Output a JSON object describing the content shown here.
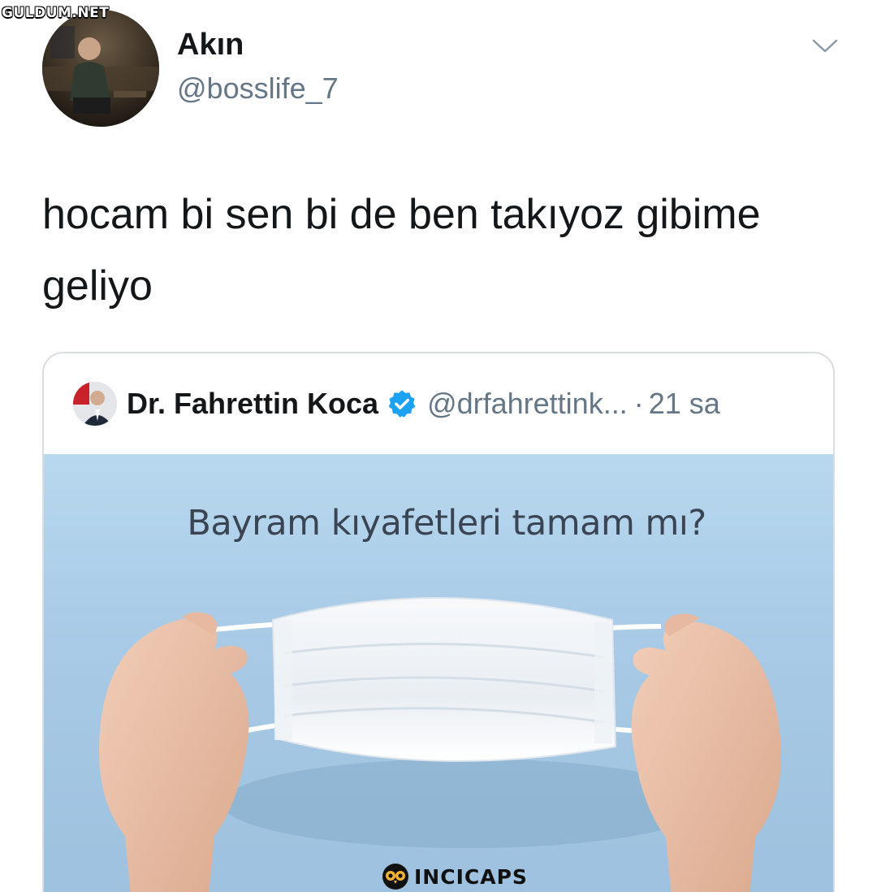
{
  "watermark": "GULDUM.NET",
  "tweet": {
    "display_name": "Akın",
    "handle": "@bosslife_7",
    "text": "hocam bi sen bi de ben takıyoz gibime geliyo"
  },
  "quoted_tweet": {
    "display_name": "Dr. Fahrettin Koca",
    "handle": "@drfahrettink...",
    "separator": "·",
    "time": "21 sa",
    "image_caption": "Bayram kıyafetleri tamam mı?"
  },
  "footer_watermark": "INCICAPS",
  "icons": {
    "menu": "chevron-down-icon",
    "verified": "verified-badge-icon",
    "watermark_logo": "owl-icon"
  },
  "colors": {
    "text": "#14171a",
    "secondary": "#657786",
    "verified": "#1da1f2",
    "border": "#d7dde2"
  }
}
